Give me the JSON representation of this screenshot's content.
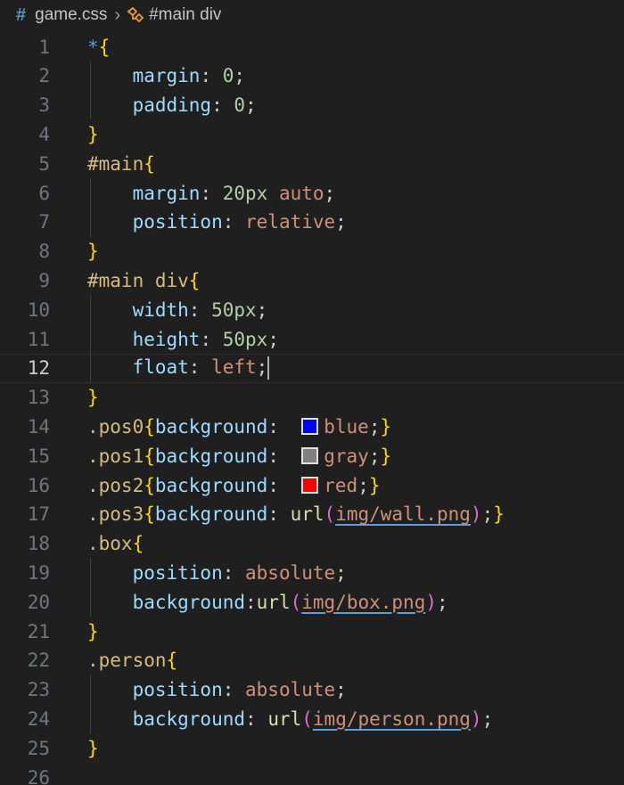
{
  "breadcrumb": {
    "file_name": "game.css",
    "symbol": "#main div"
  },
  "colors": {
    "blue": "#0000ff",
    "gray": "#808080",
    "red": "#ff0000"
  },
  "current_line": 12,
  "lines": [
    {
      "n": "1",
      "tokens": [
        [
          "star",
          "*"
        ],
        [
          "brace",
          "{"
        ]
      ]
    },
    {
      "n": "2",
      "tokens": [
        [
          "prop",
          "    margin"
        ],
        [
          "plain",
          ": "
        ],
        [
          "num",
          "0"
        ],
        [
          "plain",
          ";"
        ]
      ]
    },
    {
      "n": "3",
      "tokens": [
        [
          "prop",
          "    padding"
        ],
        [
          "plain",
          ": "
        ],
        [
          "num",
          "0"
        ],
        [
          "plain",
          ";"
        ]
      ]
    },
    {
      "n": "4",
      "tokens": [
        [
          "brace",
          "}"
        ]
      ]
    },
    {
      "n": "5",
      "tokens": [
        [
          "sel",
          "#main"
        ],
        [
          "brace",
          "{"
        ]
      ]
    },
    {
      "n": "6",
      "tokens": [
        [
          "prop",
          "    margin"
        ],
        [
          "plain",
          ": "
        ],
        [
          "num",
          "20px"
        ],
        [
          "plain",
          " "
        ],
        [
          "val",
          "auto"
        ],
        [
          "plain",
          ";"
        ]
      ]
    },
    {
      "n": "7",
      "tokens": [
        [
          "prop",
          "    position"
        ],
        [
          "plain",
          ": "
        ],
        [
          "val",
          "relative"
        ],
        [
          "plain",
          ";"
        ]
      ]
    },
    {
      "n": "8",
      "tokens": [
        [
          "brace",
          "}"
        ]
      ]
    },
    {
      "n": "9",
      "tokens": [
        [
          "sel",
          "#main div"
        ],
        [
          "brace",
          "{"
        ]
      ]
    },
    {
      "n": "10",
      "tokens": [
        [
          "prop",
          "    width"
        ],
        [
          "plain",
          ": "
        ],
        [
          "num",
          "50px"
        ],
        [
          "plain",
          ";"
        ]
      ]
    },
    {
      "n": "11",
      "tokens": [
        [
          "prop",
          "    height"
        ],
        [
          "plain",
          ": "
        ],
        [
          "num",
          "50px"
        ],
        [
          "plain",
          ";"
        ]
      ]
    },
    {
      "n": "12",
      "tokens": [
        [
          "prop",
          "    float"
        ],
        [
          "plain",
          ": "
        ],
        [
          "val",
          "left"
        ],
        [
          "plain",
          ";"
        ],
        [
          "cursor",
          ""
        ]
      ]
    },
    {
      "n": "13",
      "tokens": [
        [
          "brace",
          "}"
        ]
      ]
    },
    {
      "n": "14",
      "tokens": [
        [
          "sel",
          ".pos0"
        ],
        [
          "brace",
          "{"
        ],
        [
          "prop",
          "background"
        ],
        [
          "plain",
          ":  "
        ],
        [
          "swatch",
          "blue"
        ],
        [
          "val",
          "blue"
        ],
        [
          "plain",
          ";"
        ],
        [
          "brace",
          "}"
        ]
      ]
    },
    {
      "n": "15",
      "tokens": [
        [
          "sel",
          ".pos1"
        ],
        [
          "brace",
          "{"
        ],
        [
          "prop",
          "background"
        ],
        [
          "plain",
          ":  "
        ],
        [
          "swatch",
          "gray"
        ],
        [
          "val",
          "gray"
        ],
        [
          "plain",
          ";"
        ],
        [
          "brace",
          "}"
        ]
      ]
    },
    {
      "n": "16",
      "tokens": [
        [
          "sel",
          ".pos2"
        ],
        [
          "brace",
          "{"
        ],
        [
          "prop",
          "background"
        ],
        [
          "plain",
          ":  "
        ],
        [
          "swatch",
          "red"
        ],
        [
          "val",
          "red"
        ],
        [
          "plain",
          ";"
        ],
        [
          "brace",
          "}"
        ]
      ]
    },
    {
      "n": "17",
      "tokens": [
        [
          "sel",
          ".pos3"
        ],
        [
          "brace",
          "{"
        ],
        [
          "prop",
          "background"
        ],
        [
          "plain",
          ": "
        ],
        [
          "fn",
          "url"
        ],
        [
          "paren",
          "("
        ],
        [
          "link",
          "img/wall.png"
        ],
        [
          "paren",
          ")"
        ],
        [
          "plain",
          ";"
        ],
        [
          "brace",
          "}"
        ]
      ]
    },
    {
      "n": "18",
      "tokens": [
        [
          "sel",
          ".box"
        ],
        [
          "brace",
          "{"
        ]
      ]
    },
    {
      "n": "19",
      "tokens": [
        [
          "prop",
          "    position"
        ],
        [
          "plain",
          ": "
        ],
        [
          "val",
          "absolute"
        ],
        [
          "plain",
          ";"
        ]
      ]
    },
    {
      "n": "20",
      "tokens": [
        [
          "prop",
          "    background"
        ],
        [
          "plain",
          ":"
        ],
        [
          "fn",
          "url"
        ],
        [
          "paren",
          "("
        ],
        [
          "link",
          "img/box.png"
        ],
        [
          "paren",
          ")"
        ],
        [
          "plain",
          ";"
        ]
      ]
    },
    {
      "n": "21",
      "tokens": [
        [
          "brace",
          "}"
        ]
      ]
    },
    {
      "n": "22",
      "tokens": [
        [
          "sel",
          ".person"
        ],
        [
          "brace",
          "{"
        ]
      ]
    },
    {
      "n": "23",
      "tokens": [
        [
          "prop",
          "    position"
        ],
        [
          "plain",
          ": "
        ],
        [
          "val",
          "absolute"
        ],
        [
          "plain",
          ";"
        ]
      ]
    },
    {
      "n": "24",
      "tokens": [
        [
          "prop",
          "    background"
        ],
        [
          "plain",
          ": "
        ],
        [
          "fn",
          "url"
        ],
        [
          "paren",
          "("
        ],
        [
          "link",
          "img/person.png"
        ],
        [
          "paren",
          ")"
        ],
        [
          "plain",
          ";"
        ]
      ]
    },
    {
      "n": "25",
      "tokens": [
        [
          "brace",
          "}"
        ]
      ]
    },
    {
      "n": "26",
      "tokens": []
    }
  ]
}
